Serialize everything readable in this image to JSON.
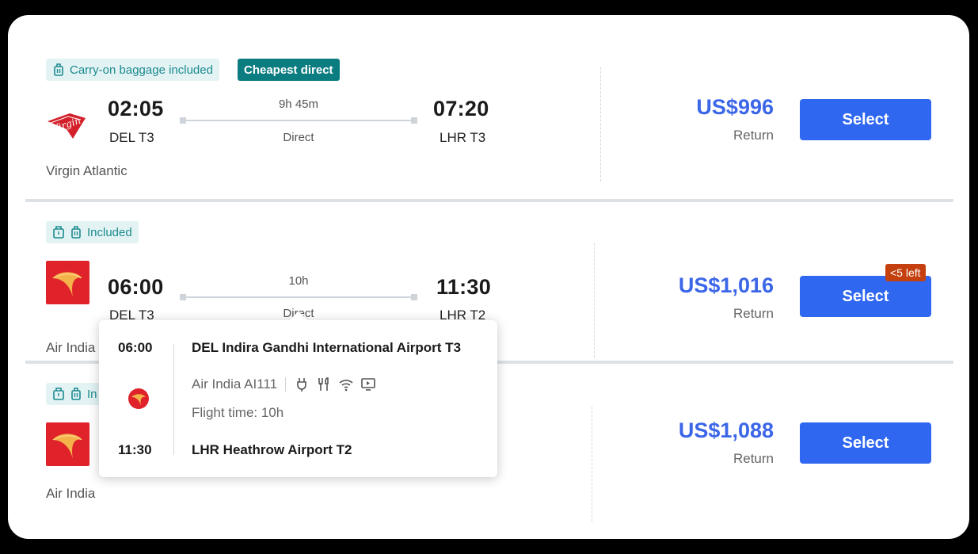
{
  "flights": [
    {
      "badges": [
        "Carry-on baggage included",
        "Cheapest direct"
      ],
      "airline": "Virgin Atlantic",
      "logo_text": "Virgin",
      "depart_time": "02:05",
      "depart_code": "DEL T3",
      "duration": "9h 45m",
      "stops": "Direct",
      "arrive_time": "07:20",
      "arrive_code": "LHR T3",
      "price": "US$996",
      "price_note": "Return",
      "select_label": "Select"
    },
    {
      "badges": [
        "Included"
      ],
      "airline": "Air India",
      "depart_time": "06:00",
      "depart_code": "DEL T3",
      "duration": "10h",
      "stops": "Direct",
      "arrive_time": "11:30",
      "arrive_code": "LHR T2",
      "price": "US$1,016",
      "price_note": "Return",
      "select_label": "Select",
      "availability": "<5 left"
    },
    {
      "badges": [
        "In"
      ],
      "airline": "Air India",
      "price": "US$1,088",
      "price_note": "Return",
      "select_label": "Select"
    }
  ],
  "tooltip": {
    "depart_time": "06:00",
    "depart_airport": "DEL Indira Gandhi International Airport T3",
    "flight": "Air India AI111",
    "flight_time": "Flight time: 10h",
    "arrive_time": "11:30",
    "arrive_airport": "LHR Heathrow Airport T2",
    "amenities": [
      "power-icon",
      "meal-icon",
      "wifi-icon",
      "entertainment-icon"
    ]
  },
  "colors": {
    "price": "#3c66e8",
    "select_button": "#2f67f0",
    "badge_teal": "#0b7c80",
    "badge_teal_light": "#e3f3f4",
    "availability": "#c4400e",
    "air_india": "#e0222b",
    "virgin": "#d3202a"
  }
}
